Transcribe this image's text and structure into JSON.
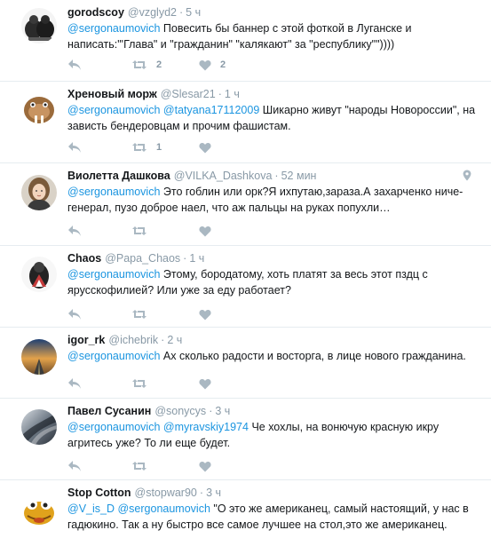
{
  "tweets": [
    {
      "name": "gorodscoy",
      "handle": "@vzglyd2",
      "time": "5 ч",
      "mention": "@sergonaumovich",
      "text": " Повесить бы баннер с этой фоткой в Луганске и написать:\"'Глава\" и \"гражданин\" \"калякают\" за \"республику\"\"))))",
      "retweets": "2",
      "likes": "2"
    },
    {
      "name": "Хреновый морж",
      "handle": "@Slesar21",
      "time": "1 ч",
      "mention": "@sergonaumovich",
      "mention2": "@tatyana17112009",
      "text": " Шикарно живут \"народы Новороссии\", на зависть бендеровцам и прочим фашистам.",
      "retweets": "1",
      "likes": ""
    },
    {
      "name": "Виолетта Дашкова",
      "handle": "@VILKA_Dashkova",
      "time": "52 мин",
      "mention": "@sergonaumovich",
      "text": " Это гоблин или орк?Я ихпутаю,зараза.А захарченко ниче-генерал, пузо доброе наел, что аж пальцы на руках попухли…",
      "retweets": "",
      "likes": ""
    },
    {
      "name": "Chaos",
      "handle": "@Papa_Chaos",
      "time": "1 ч",
      "mention": "@sergonaumovich",
      "text": " Этому, бородатому, хоть платят за весь этот пздц с ярусскофилией? Или уже за еду работает?",
      "retweets": "",
      "likes": ""
    },
    {
      "name": "igor_rk",
      "handle": "@ichebrik",
      "time": "2 ч",
      "mention": "@sergonaumovich",
      "text": " Ах сколько радости и восторга, в лице нового гражданина.",
      "retweets": "",
      "likes": ""
    },
    {
      "name": "Павел Сусанин",
      "handle": "@sonycys",
      "time": "3 ч",
      "mention": "@sergonaumovich",
      "mention2": "@myravskiy1974",
      "text": " Че хохлы, на вонючую красную икру агритесь уже? То ли еще будет.",
      "retweets": "",
      "likes": ""
    },
    {
      "name": "Stop Cotton",
      "handle": "@stopwar90",
      "time": "3 ч",
      "mention": "@V_is_D",
      "mention2": "@sergonaumovich",
      "text": " \"О это же американец, самый настоящий, у нас в гадюкино. Так а ну быстро все самое лучшее на стол,это же американец.",
      "retweets": "",
      "likes": ""
    }
  ],
  "icons": {
    "reply": "reply-icon",
    "retweet": "retweet-icon",
    "like": "heart-icon",
    "location": "location-pin-icon"
  },
  "colors": {
    "mention": "#1b95e0",
    "meta": "#8899a6",
    "icon": "#aab8c2",
    "divider": "#e6ecf0"
  }
}
